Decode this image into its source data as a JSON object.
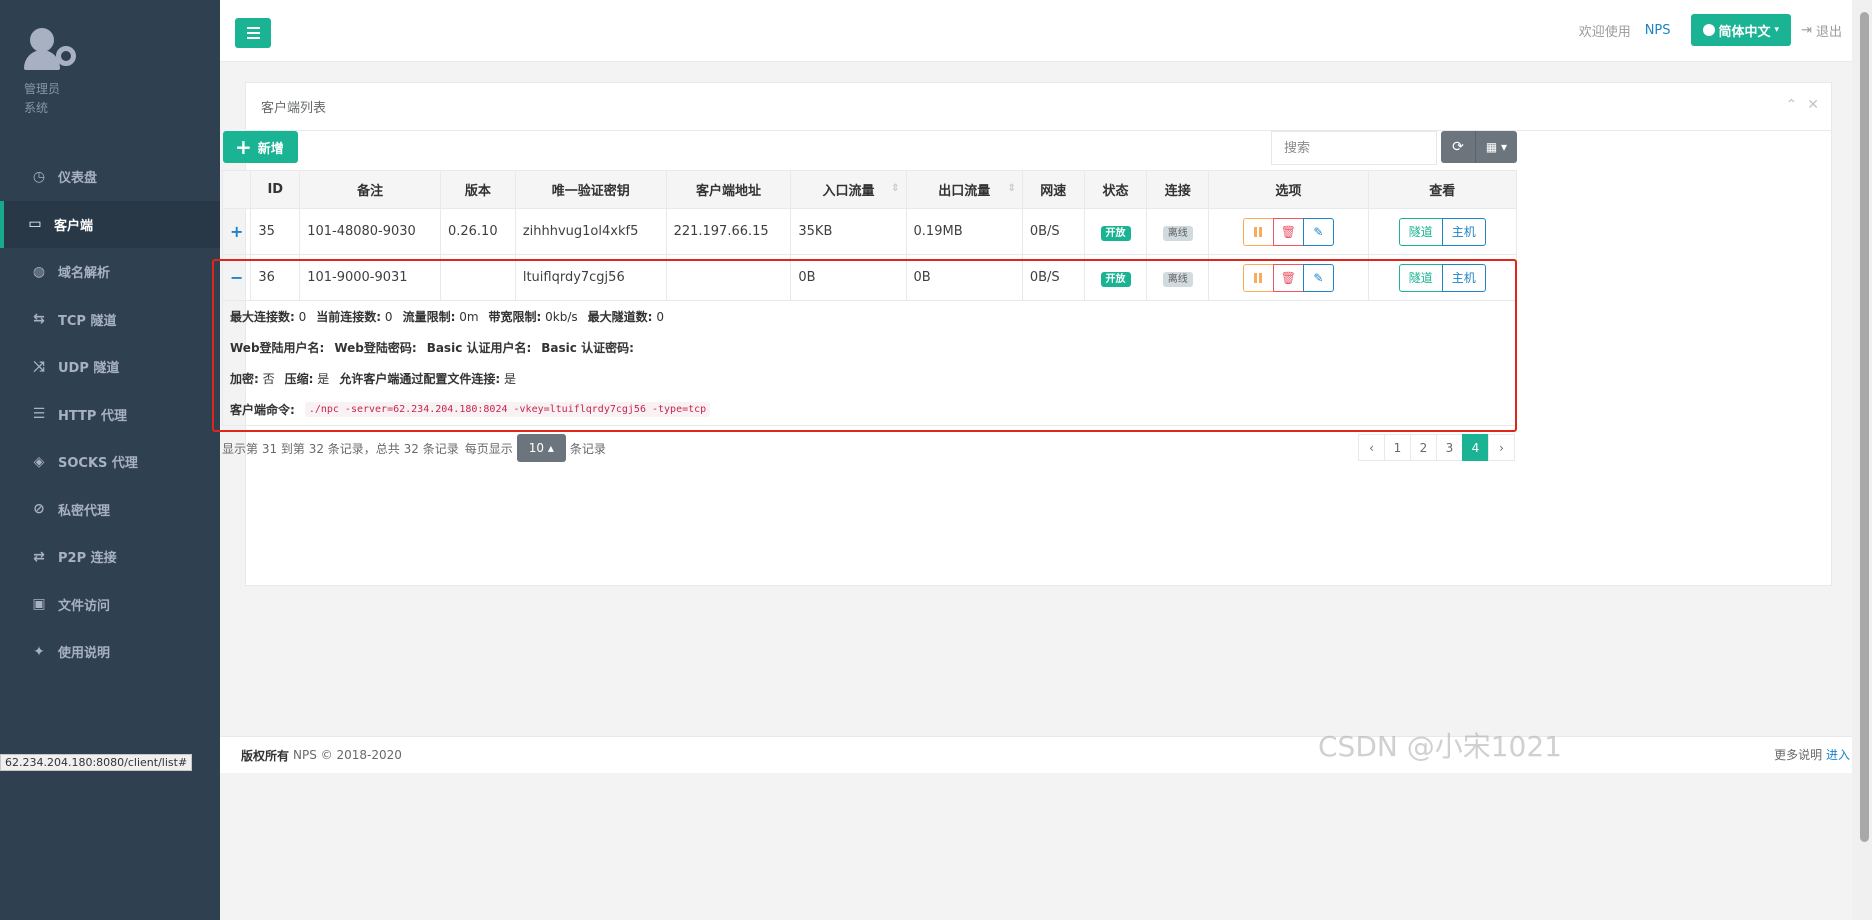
{
  "sidebar": {
    "role": "管理员",
    "system": "系统",
    "items": [
      {
        "label": "仪表盘",
        "icon": "dashboard-icon",
        "glyph": "◷"
      },
      {
        "label": "客户端",
        "icon": "monitor-icon",
        "glyph": "▭"
      },
      {
        "label": "域名解析",
        "icon": "globe-icon",
        "glyph": "◍"
      },
      {
        "label": "TCP 隧道",
        "icon": "retweet-icon",
        "glyph": "⇆"
      },
      {
        "label": "UDP 隧道",
        "icon": "random-icon",
        "glyph": "⤨"
      },
      {
        "label": "HTTP 代理",
        "icon": "server-icon",
        "glyph": "☰"
      },
      {
        "label": "SOCKS 代理",
        "icon": "layers-icon",
        "glyph": "◈"
      },
      {
        "label": "私密代理",
        "icon": "eye-slash-icon",
        "glyph": "⊘"
      },
      {
        "label": "P2P 连接",
        "icon": "exchange-icon",
        "glyph": "⇄"
      },
      {
        "label": "文件访问",
        "icon": "briefcase-icon",
        "glyph": "▣"
      },
      {
        "label": "使用说明",
        "icon": "lightbulb-icon",
        "glyph": "✦"
      }
    ]
  },
  "topbar": {
    "welcome": "欢迎使用",
    "brand": "NPS",
    "language": "简体中文",
    "logout": "退出"
  },
  "panel": {
    "title": "客户端列表",
    "add_label": "新增",
    "search_placeholder": "搜索"
  },
  "table": {
    "headers": [
      "ID",
      "备注",
      "版本",
      "唯一验证密钥",
      "客户端地址",
      "入口流量",
      "出口流量",
      "网速",
      "状态",
      "连接",
      "选项",
      "查看"
    ],
    "rows": [
      {
        "toggle": "+",
        "id": "35",
        "remark": "101-48080-9030",
        "version": "0.26.10",
        "vkey": "zihhhvug1ol4xkf5",
        "addr": "221.197.66.15",
        "in": "35KB",
        "out": "0.19MB",
        "speed": "0B/S",
        "status": "开放",
        "conn": "离线"
      },
      {
        "toggle": "−",
        "id": "36",
        "remark": "101-9000-9031",
        "version": "",
        "vkey": "ltuiflqrdy7cgj56",
        "addr": "",
        "in": "0B",
        "out": "0B",
        "speed": "0B/S",
        "status": "开放",
        "conn": "离线"
      }
    ],
    "view_tunnel": "隧道",
    "view_host": "主机"
  },
  "detail": {
    "max_conn_label": "最大连接数:",
    "max_conn": "0",
    "cur_conn_label": "当前连接数:",
    "cur_conn": "0",
    "flow_limit_label": "流量限制:",
    "flow_limit": "0m",
    "bw_limit_label": "带宽限制:",
    "bw_limit": "0kb/s",
    "max_tunnel_label": "最大隧道数:",
    "max_tunnel": "0",
    "web_user_label": "Web登陆用户名:",
    "web_pass_label": "Web登陆密码:",
    "basic_user_label": "Basic 认证用户名:",
    "basic_pass_label": "Basic 认证密码:",
    "encrypt_label": "加密:",
    "encrypt": "否",
    "compress_label": "压缩:",
    "compress": "是",
    "allow_config_label": "允许客户端通过配置文件连接:",
    "allow_config": "是",
    "cmd_label": "客户端命令:",
    "cmd": "./npc -server=62.234.204.180:8024 -vkey=ltuiflqrdy7cgj56 -type=tcp"
  },
  "pagination": {
    "info": "显示第 31 到第 32 条记录，总共 32 条记录",
    "per_page_prefix": "每页显示",
    "page_size": "10",
    "per_page_suffix": "条记录",
    "prev": "‹",
    "pages": [
      "1",
      "2",
      "3",
      "4"
    ],
    "active_page": "4",
    "next": "›"
  },
  "footer": {
    "copyright_label": "版权所有",
    "copyright": "NPS © 2018-2020",
    "more_help": "更多说明",
    "enter": "进入"
  },
  "status_url": "62.234.204.180:8080/client/list#",
  "watermark": "CSDN @小宋1021",
  "colors": {
    "accent": "#1ab394",
    "sidebar": "#2f4050",
    "link": "#1c84c6",
    "highlight": "#e1251b"
  }
}
